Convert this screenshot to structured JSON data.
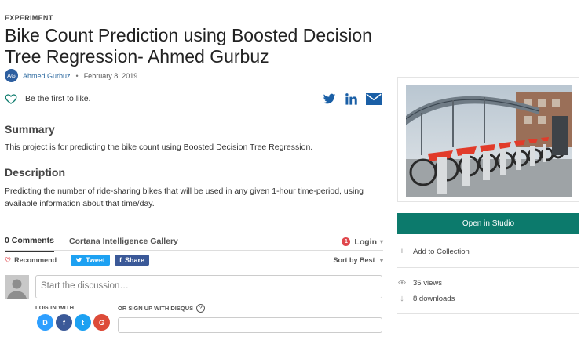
{
  "page": {
    "eyebrow": "EXPERIMENT",
    "title": "Bike Count Prediction using Boosted Decision Tree Regression- Ahmed Gurbuz",
    "avatar_initials": "AG",
    "author": "Ahmed Gurbuz",
    "separator": "•",
    "date": "February 8, 2019",
    "like_text": "Be the first to like."
  },
  "share": {
    "icons": [
      "twitter-icon",
      "linkedin-icon",
      "mail-icon"
    ],
    "colors": {
      "brand": "#1a5fa6"
    }
  },
  "summary": {
    "heading": "Summary",
    "text": "This project is for predicting the bike count using Boosted Decision Tree Regression."
  },
  "description": {
    "heading": "Description",
    "text": "Predicting the number of ride-sharing bikes that will be used in any given 1-hour time-period, using available information about that time/day."
  },
  "comments": {
    "tab_comments": "0 Comments",
    "tab_gallery": "Cortana Intelligence Gallery",
    "login_badge": "1",
    "login": "Login",
    "recommend": "Recommend",
    "tweet": "Tweet",
    "share": "Share",
    "sort": "Sort by Best",
    "placeholder": "Start the discussion…",
    "login_with": "LOG IN WITH",
    "signup": "OR SIGN UP WITH DISQUS",
    "help": "?",
    "social": [
      {
        "label": "D",
        "color": "#2e9fff"
      },
      {
        "label": "f",
        "color": "#3b5998"
      },
      {
        "label": "t",
        "color": "#1da1f2"
      },
      {
        "label": "G",
        "color": "#dd4b39"
      }
    ]
  },
  "sidebar": {
    "open_studio": "Open in Studio",
    "add_collection": "Add to Collection",
    "views": "35 views",
    "downloads": "8 downloads",
    "accent": "#0c7a6c"
  }
}
